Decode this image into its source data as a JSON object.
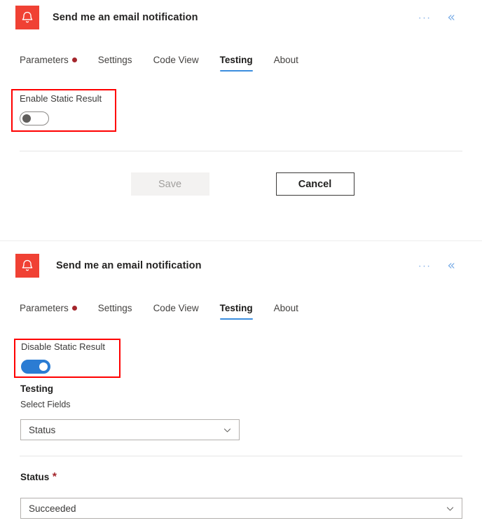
{
  "panel_one": {
    "header": {
      "icon": "bell-icon",
      "icon_color": "#f04134",
      "title": "Send me an email notification",
      "ellipsis_label": "···",
      "collapse_label": "«"
    },
    "tabs": [
      {
        "label": "Parameters",
        "dot": true,
        "active": false
      },
      {
        "label": "Settings",
        "dot": false,
        "active": false
      },
      {
        "label": "Code View",
        "dot": false,
        "active": false
      },
      {
        "label": "Testing",
        "dot": false,
        "active": true
      },
      {
        "label": "About",
        "dot": false,
        "active": false
      }
    ],
    "static_result": {
      "label": "Enable Static Result",
      "state": "off"
    },
    "buttons": {
      "save_label": "Save",
      "save_disabled": true,
      "cancel_label": "Cancel"
    }
  },
  "panel_two": {
    "header": {
      "icon": "bell-icon",
      "icon_color": "#f04134",
      "title": "Send me an email notification",
      "ellipsis_label": "···",
      "collapse_label": "«"
    },
    "tabs": [
      {
        "label": "Parameters",
        "dot": true,
        "active": false
      },
      {
        "label": "Settings",
        "dot": false,
        "active": false
      },
      {
        "label": "Code View",
        "dot": false,
        "active": false
      },
      {
        "label": "Testing",
        "dot": false,
        "active": true
      },
      {
        "label": "About",
        "dot": false,
        "active": false
      }
    ],
    "static_result": {
      "label": "Disable Static Result",
      "state": "on"
    },
    "testing": {
      "heading": "Testing",
      "select_fields_label": "Select Fields",
      "select_fields_value": "Status"
    },
    "status": {
      "label": "Status",
      "required_marker": "*",
      "value": "Succeeded"
    }
  },
  "annotations": {
    "color": "#ff0000",
    "boxes": [
      {
        "name": "enable-static-result-highlight"
      },
      {
        "name": "disable-static-result-highlight"
      }
    ]
  }
}
